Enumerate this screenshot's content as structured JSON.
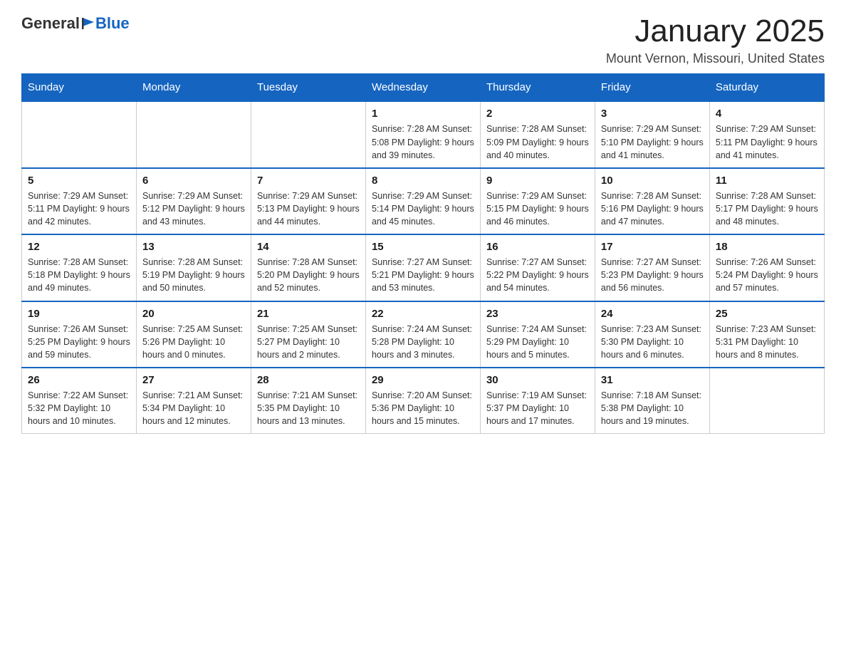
{
  "header": {
    "logo_general": "General",
    "logo_blue": "Blue",
    "month_title": "January 2025",
    "location": "Mount Vernon, Missouri, United States"
  },
  "days_of_week": [
    "Sunday",
    "Monday",
    "Tuesday",
    "Wednesday",
    "Thursday",
    "Friday",
    "Saturday"
  ],
  "weeks": [
    [
      {
        "day": "",
        "info": ""
      },
      {
        "day": "",
        "info": ""
      },
      {
        "day": "",
        "info": ""
      },
      {
        "day": "1",
        "info": "Sunrise: 7:28 AM\nSunset: 5:08 PM\nDaylight: 9 hours and 39 minutes."
      },
      {
        "day": "2",
        "info": "Sunrise: 7:28 AM\nSunset: 5:09 PM\nDaylight: 9 hours and 40 minutes."
      },
      {
        "day": "3",
        "info": "Sunrise: 7:29 AM\nSunset: 5:10 PM\nDaylight: 9 hours and 41 minutes."
      },
      {
        "day": "4",
        "info": "Sunrise: 7:29 AM\nSunset: 5:11 PM\nDaylight: 9 hours and 41 minutes."
      }
    ],
    [
      {
        "day": "5",
        "info": "Sunrise: 7:29 AM\nSunset: 5:11 PM\nDaylight: 9 hours and 42 minutes."
      },
      {
        "day": "6",
        "info": "Sunrise: 7:29 AM\nSunset: 5:12 PM\nDaylight: 9 hours and 43 minutes."
      },
      {
        "day": "7",
        "info": "Sunrise: 7:29 AM\nSunset: 5:13 PM\nDaylight: 9 hours and 44 minutes."
      },
      {
        "day": "8",
        "info": "Sunrise: 7:29 AM\nSunset: 5:14 PM\nDaylight: 9 hours and 45 minutes."
      },
      {
        "day": "9",
        "info": "Sunrise: 7:29 AM\nSunset: 5:15 PM\nDaylight: 9 hours and 46 minutes."
      },
      {
        "day": "10",
        "info": "Sunrise: 7:28 AM\nSunset: 5:16 PM\nDaylight: 9 hours and 47 minutes."
      },
      {
        "day": "11",
        "info": "Sunrise: 7:28 AM\nSunset: 5:17 PM\nDaylight: 9 hours and 48 minutes."
      }
    ],
    [
      {
        "day": "12",
        "info": "Sunrise: 7:28 AM\nSunset: 5:18 PM\nDaylight: 9 hours and 49 minutes."
      },
      {
        "day": "13",
        "info": "Sunrise: 7:28 AM\nSunset: 5:19 PM\nDaylight: 9 hours and 50 minutes."
      },
      {
        "day": "14",
        "info": "Sunrise: 7:28 AM\nSunset: 5:20 PM\nDaylight: 9 hours and 52 minutes."
      },
      {
        "day": "15",
        "info": "Sunrise: 7:27 AM\nSunset: 5:21 PM\nDaylight: 9 hours and 53 minutes."
      },
      {
        "day": "16",
        "info": "Sunrise: 7:27 AM\nSunset: 5:22 PM\nDaylight: 9 hours and 54 minutes."
      },
      {
        "day": "17",
        "info": "Sunrise: 7:27 AM\nSunset: 5:23 PM\nDaylight: 9 hours and 56 minutes."
      },
      {
        "day": "18",
        "info": "Sunrise: 7:26 AM\nSunset: 5:24 PM\nDaylight: 9 hours and 57 minutes."
      }
    ],
    [
      {
        "day": "19",
        "info": "Sunrise: 7:26 AM\nSunset: 5:25 PM\nDaylight: 9 hours and 59 minutes."
      },
      {
        "day": "20",
        "info": "Sunrise: 7:25 AM\nSunset: 5:26 PM\nDaylight: 10 hours and 0 minutes."
      },
      {
        "day": "21",
        "info": "Sunrise: 7:25 AM\nSunset: 5:27 PM\nDaylight: 10 hours and 2 minutes."
      },
      {
        "day": "22",
        "info": "Sunrise: 7:24 AM\nSunset: 5:28 PM\nDaylight: 10 hours and 3 minutes."
      },
      {
        "day": "23",
        "info": "Sunrise: 7:24 AM\nSunset: 5:29 PM\nDaylight: 10 hours and 5 minutes."
      },
      {
        "day": "24",
        "info": "Sunrise: 7:23 AM\nSunset: 5:30 PM\nDaylight: 10 hours and 6 minutes."
      },
      {
        "day": "25",
        "info": "Sunrise: 7:23 AM\nSunset: 5:31 PM\nDaylight: 10 hours and 8 minutes."
      }
    ],
    [
      {
        "day": "26",
        "info": "Sunrise: 7:22 AM\nSunset: 5:32 PM\nDaylight: 10 hours and 10 minutes."
      },
      {
        "day": "27",
        "info": "Sunrise: 7:21 AM\nSunset: 5:34 PM\nDaylight: 10 hours and 12 minutes."
      },
      {
        "day": "28",
        "info": "Sunrise: 7:21 AM\nSunset: 5:35 PM\nDaylight: 10 hours and 13 minutes."
      },
      {
        "day": "29",
        "info": "Sunrise: 7:20 AM\nSunset: 5:36 PM\nDaylight: 10 hours and 15 minutes."
      },
      {
        "day": "30",
        "info": "Sunrise: 7:19 AM\nSunset: 5:37 PM\nDaylight: 10 hours and 17 minutes."
      },
      {
        "day": "31",
        "info": "Sunrise: 7:18 AM\nSunset: 5:38 PM\nDaylight: 10 hours and 19 minutes."
      },
      {
        "day": "",
        "info": ""
      }
    ]
  ]
}
